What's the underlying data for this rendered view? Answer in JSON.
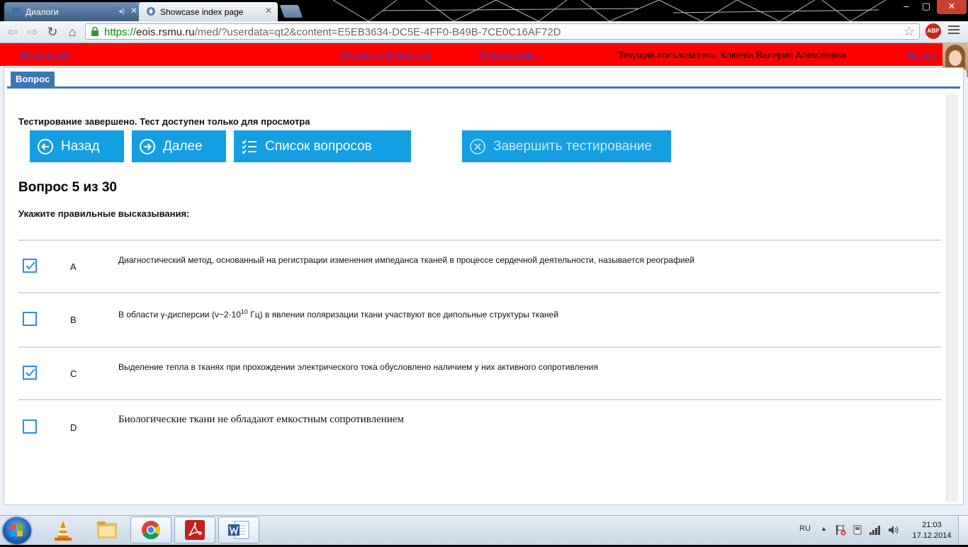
{
  "browser": {
    "tabs": [
      {
        "label": "Диалоги",
        "extra_icon": "speaker-icon",
        "active": false
      },
      {
        "label": "Showcase index page",
        "active": true
      }
    ],
    "url": {
      "scheme": "https://",
      "host": "eois.rsmu.ru",
      "path": "/med/?userdata=qt2&content=E5EB3634-DC5E-4FF0-B49B-7CE0C16AF72D"
    },
    "abp_label": "ABP"
  },
  "topbar": {
    "home_link": "На главную",
    "console_link": "Открыть веб-консоль",
    "about_link": "О программе...",
    "current_user": "Текущий пользователь: Клюева Валерия Алексеевна",
    "logout_link": "Выход"
  },
  "panel": {
    "tab_label": "Вопрос",
    "status": "Тестирование завершено. Тест доступен только для просмотра",
    "buttons": {
      "back": "Назад",
      "next": "Далее",
      "list": "Список вопросов",
      "finish": "Завершить тестирование"
    },
    "question_title": "Вопрос 5 из 30",
    "question_prompt": "Укажите правильные высказывания:",
    "answers": [
      {
        "letter": "A",
        "checked": true,
        "text": "Диагностический метод, основанный на регистрации изменения импеданса тканей в процессе сердечной деятельности, называется реографией"
      },
      {
        "letter": "B",
        "checked": false,
        "text_before": "В области γ-дисперсии (ν~2·10",
        "text_sup": "10",
        "text_after": " Гц) в явлении поляризации ткани участвуют все дипольные структуры тканей"
      },
      {
        "letter": "C",
        "checked": true,
        "text": "Выделение тепла в тканях при прохождении электрического тока обусловлено наличием у них активного сопротивления"
      },
      {
        "letter": "D",
        "checked": false,
        "text": "Биологические ткани не обладают емкостным сопротивлением"
      }
    ]
  },
  "taskbar": {
    "language": "RU",
    "time": "21:03",
    "date": "17.12.2014",
    "apps": [
      "vlc-icon",
      "file-explorer-icon",
      "chrome-icon",
      "acrobat-icon",
      "word-icon"
    ]
  },
  "colors": {
    "accent_blue": "#139fe2",
    "panel_blue": "#3e75b8",
    "red_bar": "#ff0000"
  }
}
